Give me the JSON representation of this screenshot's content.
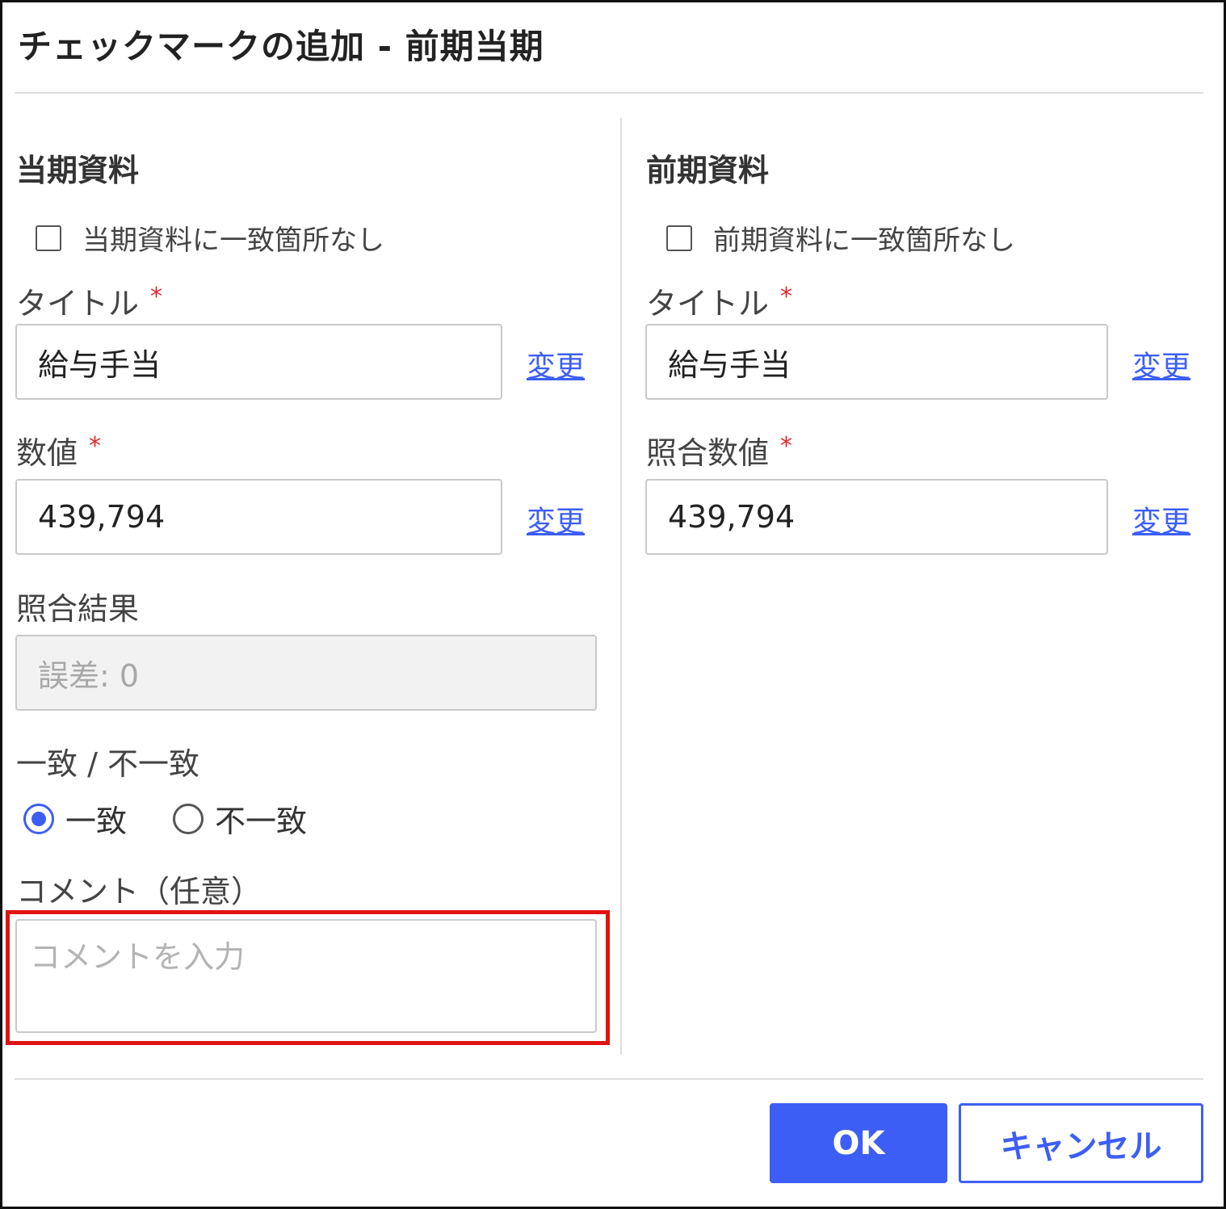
{
  "dialog": {
    "title": "チェックマークの追加 - 前期当期"
  },
  "current": {
    "section_title": "当期資料",
    "no_match_label": "当期資料に一致箇所なし",
    "title_label": "タイトル",
    "title_value": "給与手当",
    "title_change": "変更",
    "value_label": "数値",
    "value_value": "439,794",
    "value_change": "変更",
    "result_label": "照合結果",
    "result_value": "誤差: 0",
    "match_label": "一致 / 不一致",
    "match_option": "一致",
    "mismatch_option": "不一致",
    "selected": "一致",
    "comment_label": "コメント（任意）",
    "comment_placeholder": "コメントを入力"
  },
  "previous": {
    "section_title": "前期資料",
    "no_match_label": "前期資料に一致箇所なし",
    "title_label": "タイトル",
    "title_value": "給与手当",
    "title_change": "変更",
    "value_label": "照合数値",
    "value_value": "439,794",
    "value_change": "変更"
  },
  "required_mark": "*",
  "buttons": {
    "ok": "OK",
    "cancel": "キャンセル"
  },
  "colors": {
    "accent": "#3d5ef5",
    "required": "#e0282c",
    "highlight": "#e01212"
  }
}
